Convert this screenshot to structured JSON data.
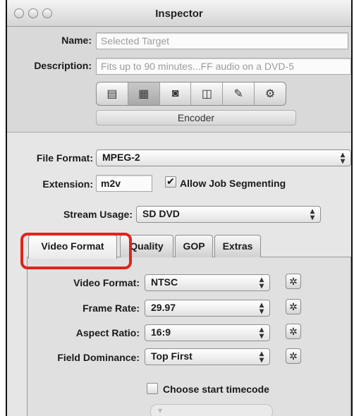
{
  "window": {
    "title": "Inspector"
  },
  "header": {
    "name_label": "Name:",
    "name_placeholder": "Selected Target",
    "description_label": "Description:",
    "description_value": "Fits up to 90 minutes...FF audio on a DVD-5",
    "pane_buttons": [
      {
        "icon": "summary-icon",
        "glyph": "▤"
      },
      {
        "icon": "encoder-icon",
        "glyph": "▦",
        "selected": true
      },
      {
        "icon": "filters-icon",
        "glyph": "◙"
      },
      {
        "icon": "frame-controls-icon",
        "glyph": "◫"
      },
      {
        "icon": "geometry-icon",
        "glyph": "✎"
      },
      {
        "icon": "actions-icon",
        "glyph": "⚙"
      }
    ],
    "pane_label": "Encoder"
  },
  "encoder": {
    "file_format_label": "File Format:",
    "file_format_value": "MPEG-2",
    "extension_label": "Extension:",
    "extension_value": "m2v",
    "allow_segmenting_label": "Allow Job Segmenting",
    "allow_segmenting_checked": true,
    "stream_usage_label": "Stream Usage:",
    "stream_usage_value": "SD DVD"
  },
  "tabs": [
    {
      "label": "Video Format",
      "active": true
    },
    {
      "label": "Quality",
      "active": false
    },
    {
      "label": "GOP",
      "active": false
    },
    {
      "label": "Extras",
      "active": false
    }
  ],
  "video_format_panel": {
    "video_format_label": "Video Format:",
    "video_format_value": "NTSC",
    "frame_rate_label": "Frame Rate:",
    "frame_rate_value": "29.97",
    "aspect_ratio_label": "Aspect Ratio:",
    "aspect_ratio_value": "16:9",
    "field_dominance_label": "Field Dominance:",
    "field_dominance_value": "Top First",
    "choose_timecode_label": "Choose start timecode",
    "choose_timecode_checked": false
  },
  "colors": {
    "highlight": "#e0241b"
  }
}
